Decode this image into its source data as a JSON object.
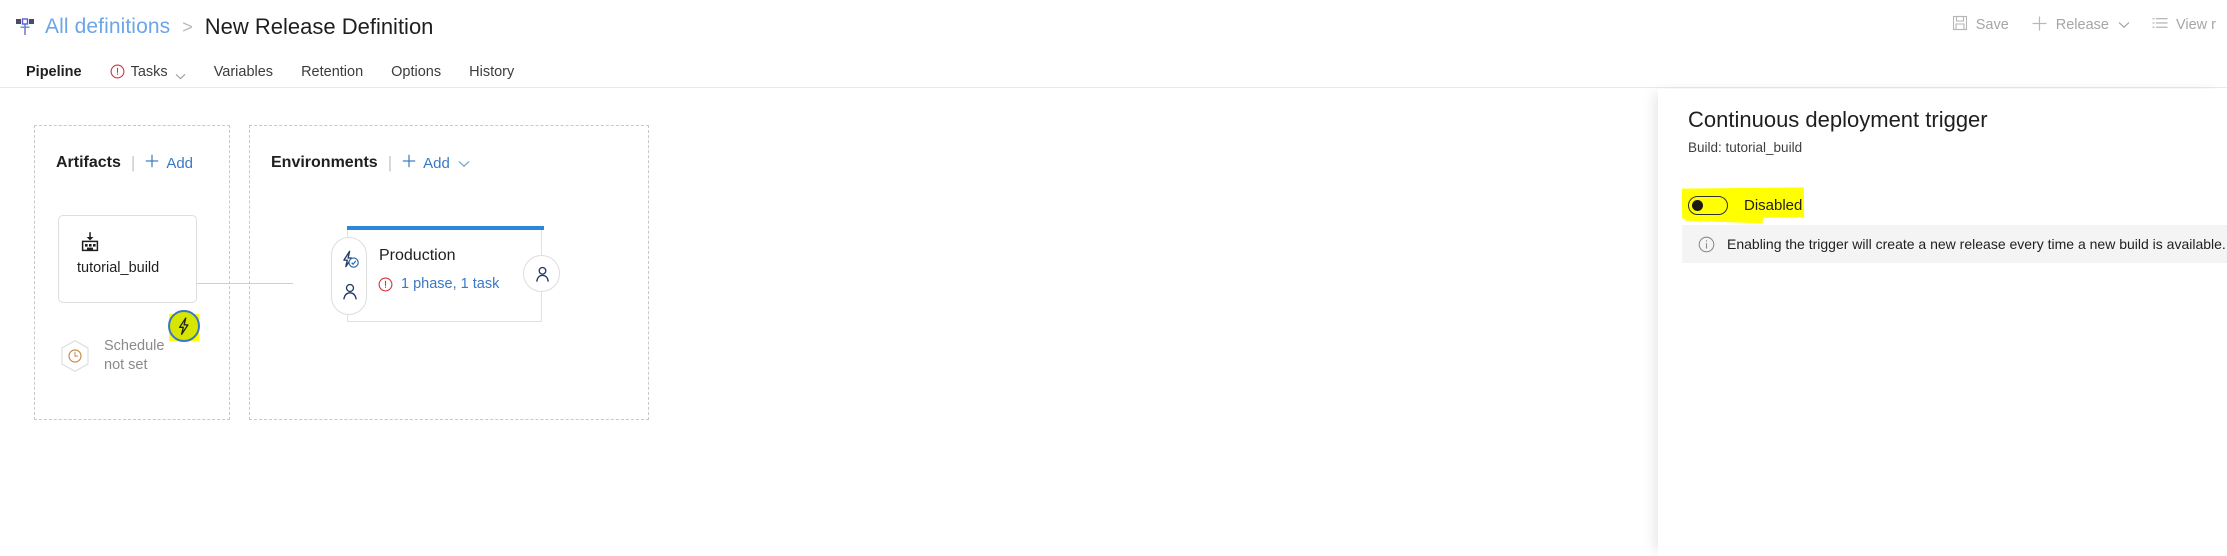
{
  "header": {
    "breadcrumb_icon": "release-pipeline-icon",
    "breadcrumb_link": "All definitions",
    "breadcrumb_separator": ">",
    "page_title": "New Release Definition",
    "tabs": [
      {
        "label": "Pipeline",
        "active": true,
        "icon": null,
        "chevron": false
      },
      {
        "label": "Tasks",
        "active": false,
        "icon": "warning-icon",
        "chevron": true
      },
      {
        "label": "Variables",
        "active": false,
        "icon": null,
        "chevron": false
      },
      {
        "label": "Retention",
        "active": false,
        "icon": null,
        "chevron": false
      },
      {
        "label": "Options",
        "active": false,
        "icon": null,
        "chevron": false
      },
      {
        "label": "History",
        "active": false,
        "icon": null,
        "chevron": false
      }
    ],
    "actions": [
      {
        "label": "Save",
        "icon": "save-icon",
        "chevron": false
      },
      {
        "label": "Release",
        "icon": "plus-icon",
        "chevron": true
      },
      {
        "label": "View r",
        "icon": "list-icon",
        "chevron": false
      }
    ]
  },
  "canvas": {
    "artifacts_panel": {
      "title": "Artifacts",
      "divider": "|",
      "add_label": "Add",
      "artifact": {
        "name": "tutorial_build",
        "icon": "build-artifact-icon",
        "cd_trigger_badge": "lightning-bolt-icon"
      },
      "schedule": {
        "icon": "clock-icon",
        "line1": "Schedule",
        "line2": "not set"
      }
    },
    "environments_panel": {
      "title": "Environments",
      "divider": "|",
      "add_label": "Add",
      "environment": {
        "name": "Production",
        "status_icon": "error-icon",
        "status_text": "1 phase, 1 task",
        "pre_deploy_icons": [
          "lightning-check-icon",
          "person-icon"
        ],
        "post_deploy_icons": [
          "person-icon"
        ]
      }
    }
  },
  "right_panel": {
    "title": "Continuous deployment trigger",
    "subtitle": "Build: tutorial_build",
    "toggle": {
      "label": "Disabled",
      "state": "off",
      "highlighted": true
    },
    "info": {
      "icon": "info-icon",
      "message": "Enabling the trigger will create a new release every time a new build is available."
    }
  },
  "colors": {
    "accent": "#0078d4",
    "link": "#3b78c4",
    "breadcrumb_link": "#6ca5e8",
    "error": "#d13438",
    "highlight": "#ffff00",
    "env_topbar": "#2b88d8",
    "info_bg": "#f4f4f4",
    "badge_fill": "#d7e600"
  }
}
